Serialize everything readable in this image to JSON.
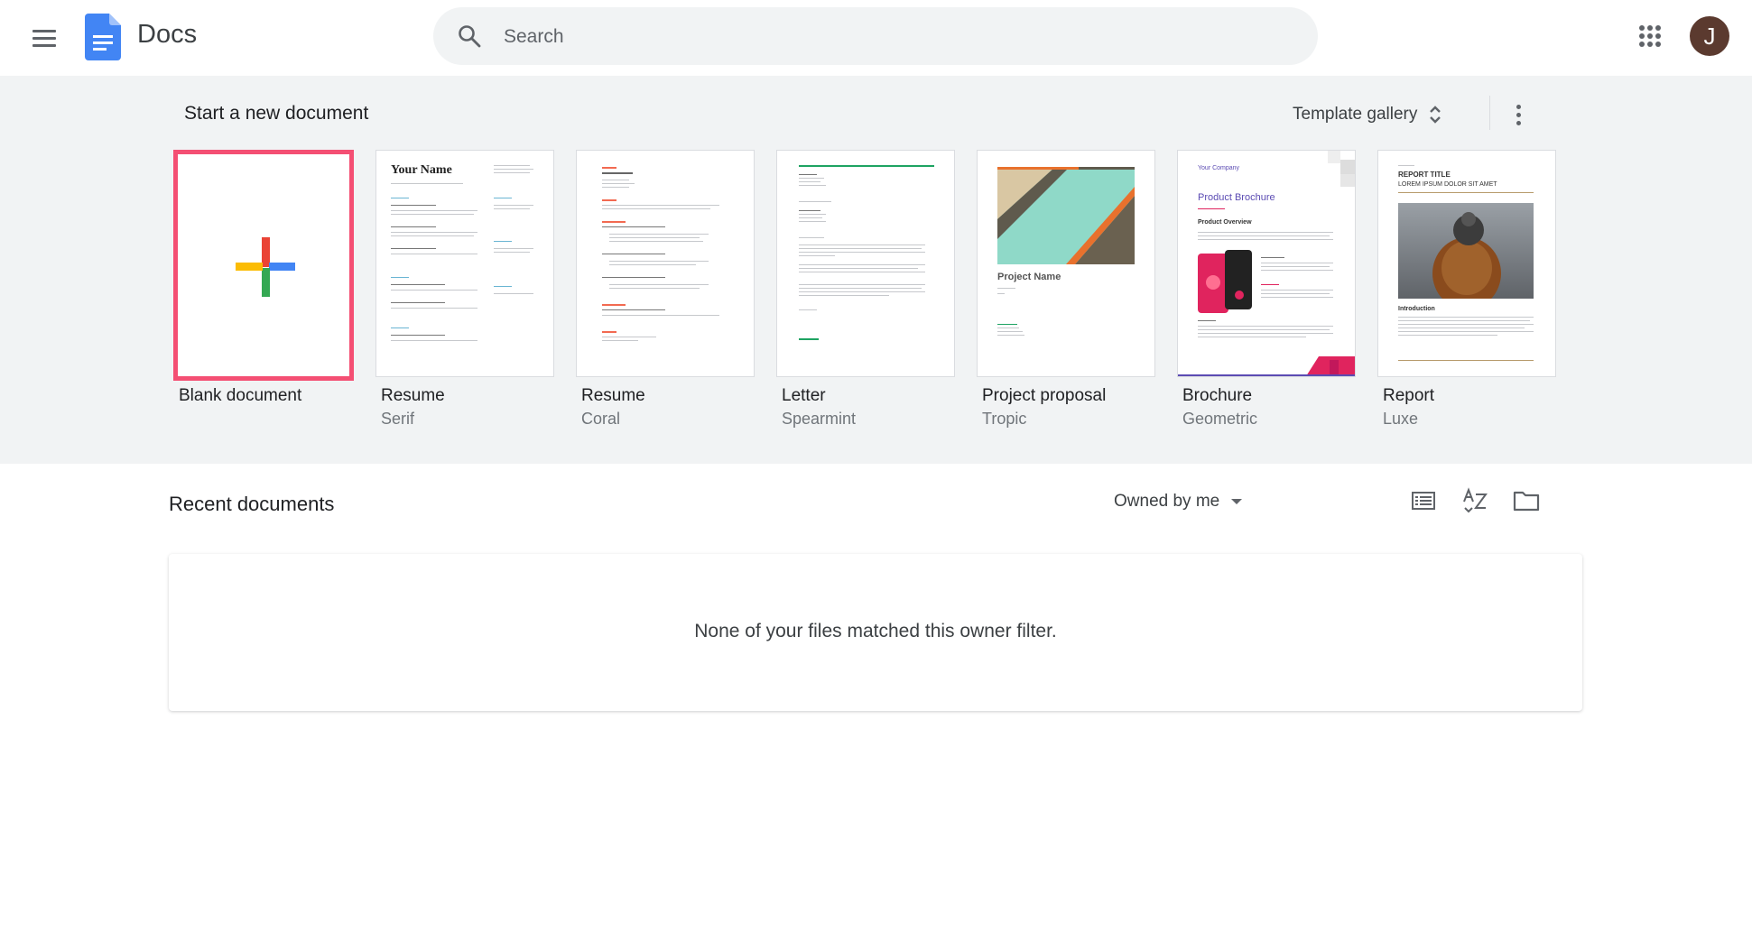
{
  "header": {
    "app_title": "Docs",
    "search_placeholder": "Search",
    "avatar_initial": "J",
    "icons": [
      "main-menu-icon",
      "docs-logo-icon",
      "search-icon",
      "apps-grid-icon"
    ]
  },
  "templates": {
    "section_title": "Start a new document",
    "gallery_label": "Template gallery",
    "cards": [
      {
        "name": "Blank document",
        "sub": ""
      },
      {
        "name": "Resume",
        "sub": "Serif"
      },
      {
        "name": "Resume",
        "sub": "Coral"
      },
      {
        "name": "Letter",
        "sub": "Spearmint"
      },
      {
        "name": "Project proposal",
        "sub": "Tropic"
      },
      {
        "name": "Brochure",
        "sub": "Geometric"
      },
      {
        "name": "Report",
        "sub": "Luxe"
      }
    ],
    "thumb_text": {
      "resume_serif_name": "Your Name",
      "proposal_title": "Project Name",
      "brochure_company": "Your Company",
      "brochure_title": "Product Brochure",
      "brochure_overview": "Product Overview",
      "report_title": "REPORT TITLE",
      "report_subtitle": "LOREM IPSUM DOLOR SIT AMET",
      "report_intro": "Introduction"
    }
  },
  "recent": {
    "title": "Recent documents",
    "owner_filter_label": "Owned by me",
    "empty_message": "None of your files matched this owner filter.",
    "tool_icons": [
      "list-view-icon",
      "sort-az-icon",
      "folder-icon"
    ]
  },
  "colors": {
    "accent_docs_blue": "#4285f4",
    "blank_highlight": "#f44f73",
    "gray_bg": "#f1f3f4",
    "avatar_bg": "#5b3a2f",
    "spearmint": "#1ea362",
    "tropic_teal": "#8fd9c8",
    "tropic_orange": "#e8712d",
    "geometric_pink": "#e0245e"
  }
}
